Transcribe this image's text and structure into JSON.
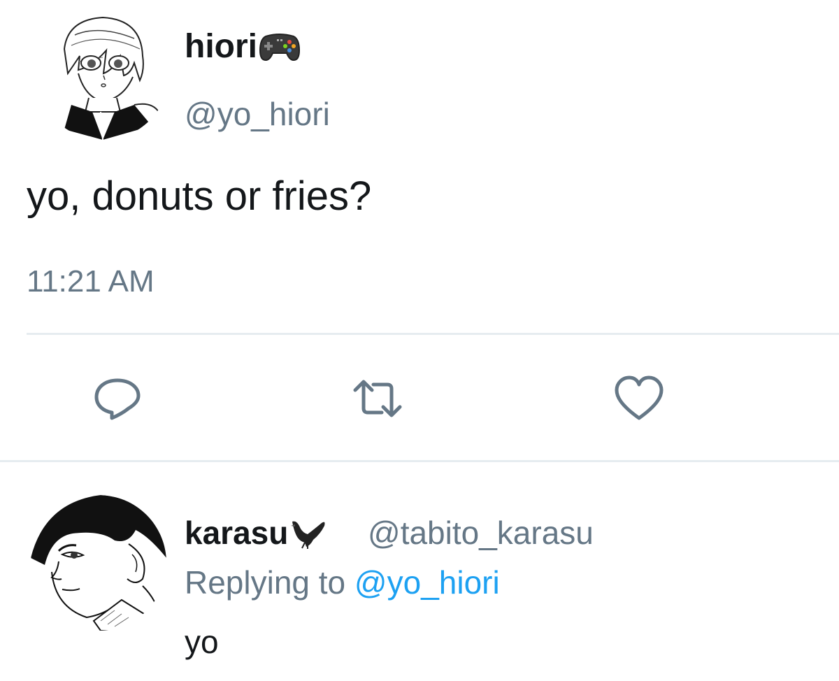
{
  "tweet": {
    "author": {
      "display_name": "hiori",
      "name_emoji": "video-game-controller-emoji",
      "handle": "@yo_hiori",
      "avatar": "anime-boy-avatar"
    },
    "text": "yo, donuts or fries?",
    "timestamp": "11:21 AM",
    "actions": {
      "reply_icon": "speech-bubble-icon",
      "retweet_icon": "retweet-arrows-icon",
      "like_icon": "heart-outline-icon"
    }
  },
  "reply": {
    "author": {
      "display_name": "karasu",
      "name_emoji": "black-bird-emoji",
      "handle": "@tabito_karasu",
      "avatar": "anime-boy-side-profile-avatar"
    },
    "replying_to_prefix": "Replying to",
    "replying_to_handle": "@yo_hiori",
    "text": "yo"
  },
  "colors": {
    "text_primary": "#14171a",
    "text_secondary": "#657786",
    "link": "#1da1f2",
    "divider": "#e6ecf0",
    "icon": "#657786"
  }
}
